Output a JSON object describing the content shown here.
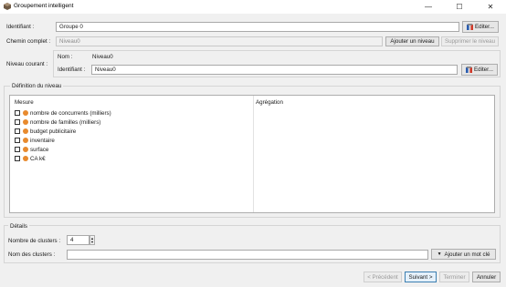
{
  "window": {
    "title": "Groupement intelligent",
    "minimize_glyph": "—",
    "maximize_glyph": "☐",
    "close_glyph": "✕"
  },
  "form": {
    "identifiant_label": "Identifiant :",
    "identifiant_value": "Groupe 0",
    "edit_label": "Editer...",
    "chemin_label": "Chemin complet :",
    "chemin_value": "Niveau0",
    "add_level_label": "Ajouter un niveau",
    "delete_level_label": "Supprimer le niveau"
  },
  "level": {
    "section_label": "Niveau courant :",
    "nom_label": "Nom :",
    "nom_value": "Niveau0",
    "identifiant_label": "Identifiant :",
    "identifiant_value": "Niveau0",
    "edit_label": "Editer..."
  },
  "definition": {
    "title": "Définition du niveau",
    "col_mesure": "Mesure",
    "col_aggregation": "Agrégation",
    "measures": [
      "nombre de concurrents (milliers)",
      "nombre de familles (milliers)",
      "budget publicitaire",
      "inventaire",
      "surface",
      "CA k€"
    ]
  },
  "details": {
    "title": "Détails",
    "clusters_label": "Nombre de clusters :",
    "clusters_value": "4",
    "names_label": "Nom des clusters :",
    "names_value": "",
    "add_keyword_label": "Ajouter un mot clé"
  },
  "footer": {
    "prev_label": "< Précédent",
    "next_label": "Suivant >",
    "finish_label": "Terminer",
    "cancel_label": "Annuler"
  },
  "colors": {
    "measure_dot": "#e88a2e",
    "accent_border": "#3c7fb1"
  }
}
